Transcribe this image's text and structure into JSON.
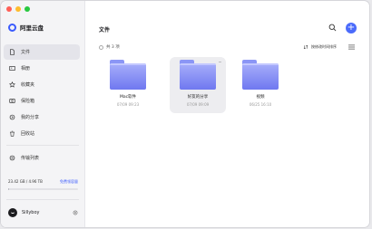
{
  "colors": {
    "accent": "#3b5bfd",
    "close": "#ff5f57",
    "minimize": "#febc2e",
    "zoom": "#28c840",
    "folder": "#7c84f2"
  },
  "app": {
    "name": "阿里云盘"
  },
  "sidebar": {
    "items": [
      {
        "label": "文件",
        "icon": "file-icon",
        "active": true
      },
      {
        "label": "相册",
        "icon": "photo-icon",
        "active": false
      },
      {
        "label": "收藏夹",
        "icon": "star-icon",
        "active": false
      },
      {
        "label": "保险箱",
        "icon": "safe-icon",
        "active": false
      },
      {
        "label": "我的分享",
        "icon": "share-icon",
        "active": false
      },
      {
        "label": "回收站",
        "icon": "trash-icon",
        "active": false
      }
    ],
    "transfer": {
      "label": "传输列表",
      "icon": "transfer-icon"
    },
    "storage": {
      "used_text": "23.42 GB / 4.96 TB",
      "buy_label": "免费领容量",
      "used_fraction": 0.0046
    },
    "user": {
      "name": "Sillyboy"
    }
  },
  "main": {
    "title": "文件",
    "count_label": "共 3 项",
    "sort_label": "按修改时间排序",
    "files": [
      {
        "name": "Mac软件",
        "date": "07/09 09:23",
        "selected": false
      },
      {
        "name": "好友的分享",
        "date": "07/09 09:09",
        "selected": true
      },
      {
        "name": "视频",
        "date": "06/25 16:10",
        "selected": false
      }
    ]
  }
}
